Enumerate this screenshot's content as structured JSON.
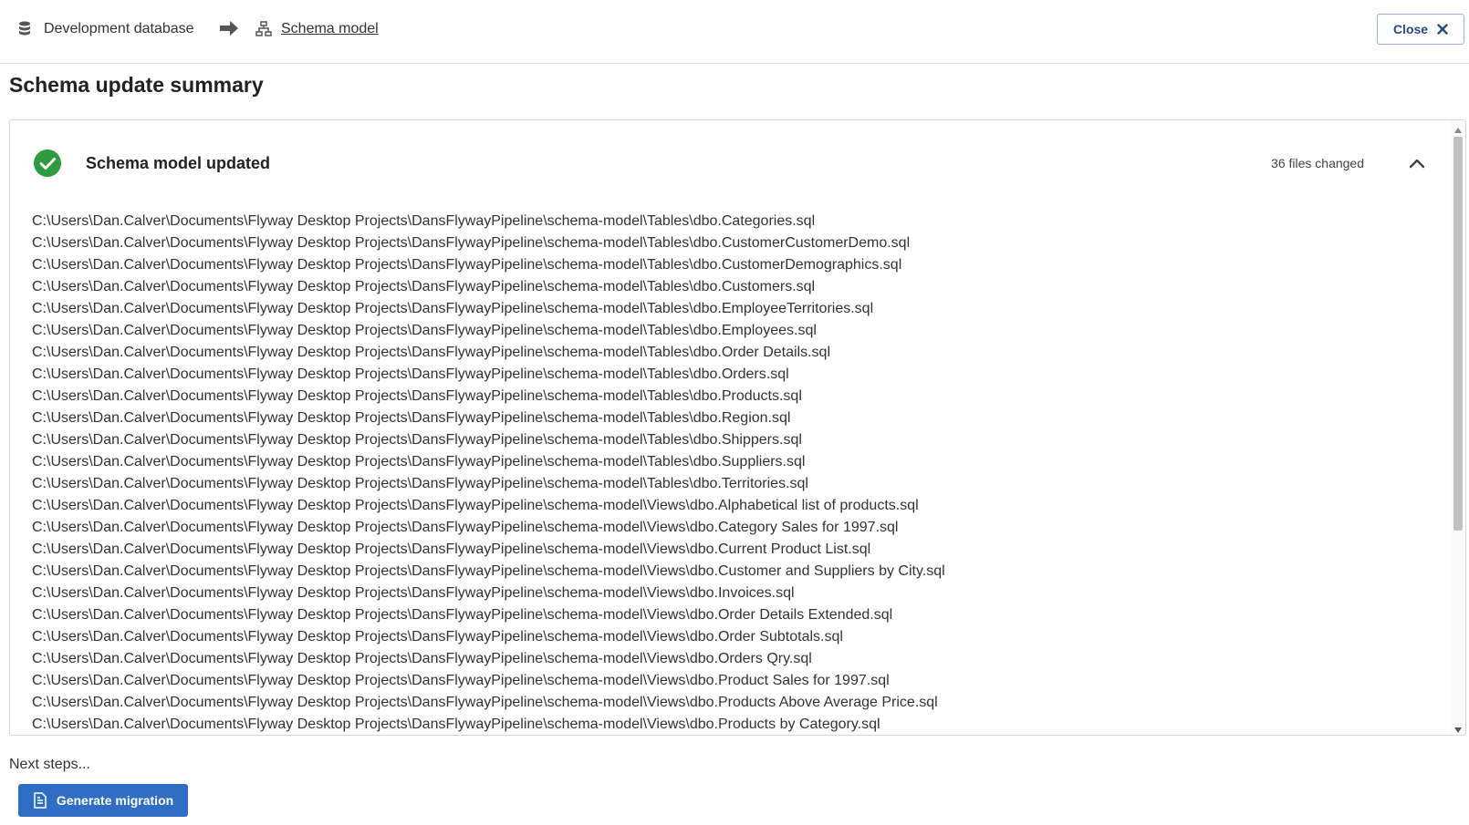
{
  "breadcrumb": {
    "database_label": "Development database",
    "schema_label": "Schema model"
  },
  "close_button": {
    "label": "Close"
  },
  "page_title": "Schema update summary",
  "summary": {
    "status_title": "Schema model updated",
    "files_changed": "36 files changed",
    "status_color": "#2e9b3e"
  },
  "files": [
    "C:\\Users\\Dan.Calver\\Documents\\Flyway Desktop Projects\\DansFlywayPipeline\\schema-model\\Tables\\dbo.Categories.sql",
    "C:\\Users\\Dan.Calver\\Documents\\Flyway Desktop Projects\\DansFlywayPipeline\\schema-model\\Tables\\dbo.CustomerCustomerDemo.sql",
    "C:\\Users\\Dan.Calver\\Documents\\Flyway Desktop Projects\\DansFlywayPipeline\\schema-model\\Tables\\dbo.CustomerDemographics.sql",
    "C:\\Users\\Dan.Calver\\Documents\\Flyway Desktop Projects\\DansFlywayPipeline\\schema-model\\Tables\\dbo.Customers.sql",
    "C:\\Users\\Dan.Calver\\Documents\\Flyway Desktop Projects\\DansFlywayPipeline\\schema-model\\Tables\\dbo.EmployeeTerritories.sql",
    "C:\\Users\\Dan.Calver\\Documents\\Flyway Desktop Projects\\DansFlywayPipeline\\schema-model\\Tables\\dbo.Employees.sql",
    "C:\\Users\\Dan.Calver\\Documents\\Flyway Desktop Projects\\DansFlywayPipeline\\schema-model\\Tables\\dbo.Order Details.sql",
    "C:\\Users\\Dan.Calver\\Documents\\Flyway Desktop Projects\\DansFlywayPipeline\\schema-model\\Tables\\dbo.Orders.sql",
    "C:\\Users\\Dan.Calver\\Documents\\Flyway Desktop Projects\\DansFlywayPipeline\\schema-model\\Tables\\dbo.Products.sql",
    "C:\\Users\\Dan.Calver\\Documents\\Flyway Desktop Projects\\DansFlywayPipeline\\schema-model\\Tables\\dbo.Region.sql",
    "C:\\Users\\Dan.Calver\\Documents\\Flyway Desktop Projects\\DansFlywayPipeline\\schema-model\\Tables\\dbo.Shippers.sql",
    "C:\\Users\\Dan.Calver\\Documents\\Flyway Desktop Projects\\DansFlywayPipeline\\schema-model\\Tables\\dbo.Suppliers.sql",
    "C:\\Users\\Dan.Calver\\Documents\\Flyway Desktop Projects\\DansFlywayPipeline\\schema-model\\Tables\\dbo.Territories.sql",
    "C:\\Users\\Dan.Calver\\Documents\\Flyway Desktop Projects\\DansFlywayPipeline\\schema-model\\Views\\dbo.Alphabetical list of products.sql",
    "C:\\Users\\Dan.Calver\\Documents\\Flyway Desktop Projects\\DansFlywayPipeline\\schema-model\\Views\\dbo.Category Sales for 1997.sql",
    "C:\\Users\\Dan.Calver\\Documents\\Flyway Desktop Projects\\DansFlywayPipeline\\schema-model\\Views\\dbo.Current Product List.sql",
    "C:\\Users\\Dan.Calver\\Documents\\Flyway Desktop Projects\\DansFlywayPipeline\\schema-model\\Views\\dbo.Customer and Suppliers by City.sql",
    "C:\\Users\\Dan.Calver\\Documents\\Flyway Desktop Projects\\DansFlywayPipeline\\schema-model\\Views\\dbo.Invoices.sql",
    "C:\\Users\\Dan.Calver\\Documents\\Flyway Desktop Projects\\DansFlywayPipeline\\schema-model\\Views\\dbo.Order Details Extended.sql",
    "C:\\Users\\Dan.Calver\\Documents\\Flyway Desktop Projects\\DansFlywayPipeline\\schema-model\\Views\\dbo.Order Subtotals.sql",
    "C:\\Users\\Dan.Calver\\Documents\\Flyway Desktop Projects\\DansFlywayPipeline\\schema-model\\Views\\dbo.Orders Qry.sql",
    "C:\\Users\\Dan.Calver\\Documents\\Flyway Desktop Projects\\DansFlywayPipeline\\schema-model\\Views\\dbo.Product Sales for 1997.sql",
    "C:\\Users\\Dan.Calver\\Documents\\Flyway Desktop Projects\\DansFlywayPipeline\\schema-model\\Views\\dbo.Products Above Average Price.sql",
    "C:\\Users\\Dan.Calver\\Documents\\Flyway Desktop Projects\\DansFlywayPipeline\\schema-model\\Views\\dbo.Products by Category.sql"
  ],
  "next_steps": {
    "label": "Next steps...",
    "generate_button": "Generate migration"
  },
  "colors": {
    "accent": "#2f6ec4",
    "close_text": "#2b4a80"
  },
  "icons": {
    "database": "database-icon",
    "arrow": "arrow-right-icon",
    "schema": "hierarchy-icon",
    "close": "close-icon",
    "success": "check-circle-icon",
    "collapse": "chevron-up-icon",
    "document": "document-icon"
  }
}
